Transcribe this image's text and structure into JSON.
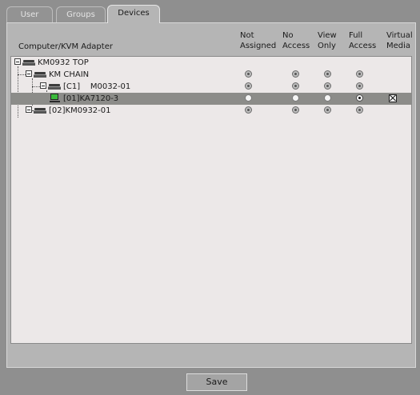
{
  "tabs": [
    {
      "label": "User",
      "active": false
    },
    {
      "label": "Groups",
      "active": false
    },
    {
      "label": "Devices",
      "active": true
    }
  ],
  "columns": {
    "device": "Computer/KVM Adapter",
    "not_assigned": [
      "Not",
      "Assigned"
    ],
    "no_access": [
      "No",
      "Access"
    ],
    "view_only": [
      "View",
      "Only"
    ],
    "full_access": [
      "Full",
      "Access"
    ],
    "virtual_media": [
      "Virtual",
      "Media"
    ]
  },
  "rows": [
    {
      "label": "KM0932 TOP",
      "icon": "kvm-switch-icon",
      "access": "not-assigned",
      "radio_states": [
        "none",
        "none",
        "none",
        "none"
      ],
      "virtual_media": false
    },
    {
      "label": "KM CHAIN",
      "icon": "kvm-switch-icon",
      "access": "not-assigned",
      "radio_states": [
        "dis",
        "dis",
        "dis",
        "dis"
      ],
      "virtual_media": false
    },
    {
      "label": "[C1]    M0032-01",
      "icon": "kvm-switch-icon",
      "access": "not-assigned",
      "radio_states": [
        "dis",
        "dis",
        "dis",
        "dis"
      ],
      "virtual_media": false
    },
    {
      "label": "[01]KA7120-3",
      "icon": "computer-icon",
      "access": "full-access",
      "radio_states": [
        "off",
        "off",
        "off",
        "on"
      ],
      "virtual_media": true,
      "selected": true
    },
    {
      "label": "[02]KM0932-01",
      "icon": "kvm-switch-icon",
      "access": "not-assigned",
      "radio_states": [
        "dis",
        "dis",
        "dis",
        "dis"
      ],
      "virtual_media": false
    }
  ],
  "save_label": "Save",
  "colors": {
    "selected_row": "#8c8c89",
    "list_bg": "#ece8e8",
    "window_bg": "#8f8f8f",
    "computer_screen": "#3bb93b"
  }
}
